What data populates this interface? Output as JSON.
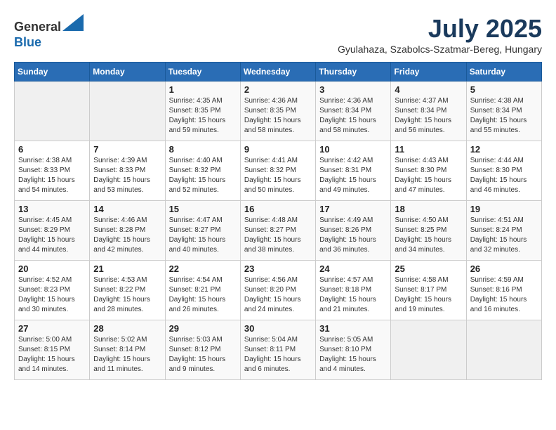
{
  "header": {
    "logo_line1": "General",
    "logo_line2": "Blue",
    "month_title": "July 2025",
    "location": "Gyulahaza, Szabolcs-Szatmar-Bereg, Hungary"
  },
  "weekdays": [
    "Sunday",
    "Monday",
    "Tuesday",
    "Wednesday",
    "Thursday",
    "Friday",
    "Saturday"
  ],
  "weeks": [
    [
      {
        "day": "",
        "info": ""
      },
      {
        "day": "",
        "info": ""
      },
      {
        "day": "1",
        "info": "Sunrise: 4:35 AM\nSunset: 8:35 PM\nDaylight: 15 hours and 59 minutes."
      },
      {
        "day": "2",
        "info": "Sunrise: 4:36 AM\nSunset: 8:35 PM\nDaylight: 15 hours and 58 minutes."
      },
      {
        "day": "3",
        "info": "Sunrise: 4:36 AM\nSunset: 8:34 PM\nDaylight: 15 hours and 58 minutes."
      },
      {
        "day": "4",
        "info": "Sunrise: 4:37 AM\nSunset: 8:34 PM\nDaylight: 15 hours and 56 minutes."
      },
      {
        "day": "5",
        "info": "Sunrise: 4:38 AM\nSunset: 8:34 PM\nDaylight: 15 hours and 55 minutes."
      }
    ],
    [
      {
        "day": "6",
        "info": "Sunrise: 4:38 AM\nSunset: 8:33 PM\nDaylight: 15 hours and 54 minutes."
      },
      {
        "day": "7",
        "info": "Sunrise: 4:39 AM\nSunset: 8:33 PM\nDaylight: 15 hours and 53 minutes."
      },
      {
        "day": "8",
        "info": "Sunrise: 4:40 AM\nSunset: 8:32 PM\nDaylight: 15 hours and 52 minutes."
      },
      {
        "day": "9",
        "info": "Sunrise: 4:41 AM\nSunset: 8:32 PM\nDaylight: 15 hours and 50 minutes."
      },
      {
        "day": "10",
        "info": "Sunrise: 4:42 AM\nSunset: 8:31 PM\nDaylight: 15 hours and 49 minutes."
      },
      {
        "day": "11",
        "info": "Sunrise: 4:43 AM\nSunset: 8:30 PM\nDaylight: 15 hours and 47 minutes."
      },
      {
        "day": "12",
        "info": "Sunrise: 4:44 AM\nSunset: 8:30 PM\nDaylight: 15 hours and 46 minutes."
      }
    ],
    [
      {
        "day": "13",
        "info": "Sunrise: 4:45 AM\nSunset: 8:29 PM\nDaylight: 15 hours and 44 minutes."
      },
      {
        "day": "14",
        "info": "Sunrise: 4:46 AM\nSunset: 8:28 PM\nDaylight: 15 hours and 42 minutes."
      },
      {
        "day": "15",
        "info": "Sunrise: 4:47 AM\nSunset: 8:27 PM\nDaylight: 15 hours and 40 minutes."
      },
      {
        "day": "16",
        "info": "Sunrise: 4:48 AM\nSunset: 8:27 PM\nDaylight: 15 hours and 38 minutes."
      },
      {
        "day": "17",
        "info": "Sunrise: 4:49 AM\nSunset: 8:26 PM\nDaylight: 15 hours and 36 minutes."
      },
      {
        "day": "18",
        "info": "Sunrise: 4:50 AM\nSunset: 8:25 PM\nDaylight: 15 hours and 34 minutes."
      },
      {
        "day": "19",
        "info": "Sunrise: 4:51 AM\nSunset: 8:24 PM\nDaylight: 15 hours and 32 minutes."
      }
    ],
    [
      {
        "day": "20",
        "info": "Sunrise: 4:52 AM\nSunset: 8:23 PM\nDaylight: 15 hours and 30 minutes."
      },
      {
        "day": "21",
        "info": "Sunrise: 4:53 AM\nSunset: 8:22 PM\nDaylight: 15 hours and 28 minutes."
      },
      {
        "day": "22",
        "info": "Sunrise: 4:54 AM\nSunset: 8:21 PM\nDaylight: 15 hours and 26 minutes."
      },
      {
        "day": "23",
        "info": "Sunrise: 4:56 AM\nSunset: 8:20 PM\nDaylight: 15 hours and 24 minutes."
      },
      {
        "day": "24",
        "info": "Sunrise: 4:57 AM\nSunset: 8:18 PM\nDaylight: 15 hours and 21 minutes."
      },
      {
        "day": "25",
        "info": "Sunrise: 4:58 AM\nSunset: 8:17 PM\nDaylight: 15 hours and 19 minutes."
      },
      {
        "day": "26",
        "info": "Sunrise: 4:59 AM\nSunset: 8:16 PM\nDaylight: 15 hours and 16 minutes."
      }
    ],
    [
      {
        "day": "27",
        "info": "Sunrise: 5:00 AM\nSunset: 8:15 PM\nDaylight: 15 hours and 14 minutes."
      },
      {
        "day": "28",
        "info": "Sunrise: 5:02 AM\nSunset: 8:14 PM\nDaylight: 15 hours and 11 minutes."
      },
      {
        "day": "29",
        "info": "Sunrise: 5:03 AM\nSunset: 8:12 PM\nDaylight: 15 hours and 9 minutes."
      },
      {
        "day": "30",
        "info": "Sunrise: 5:04 AM\nSunset: 8:11 PM\nDaylight: 15 hours and 6 minutes."
      },
      {
        "day": "31",
        "info": "Sunrise: 5:05 AM\nSunset: 8:10 PM\nDaylight: 15 hours and 4 minutes."
      },
      {
        "day": "",
        "info": ""
      },
      {
        "day": "",
        "info": ""
      }
    ]
  ]
}
